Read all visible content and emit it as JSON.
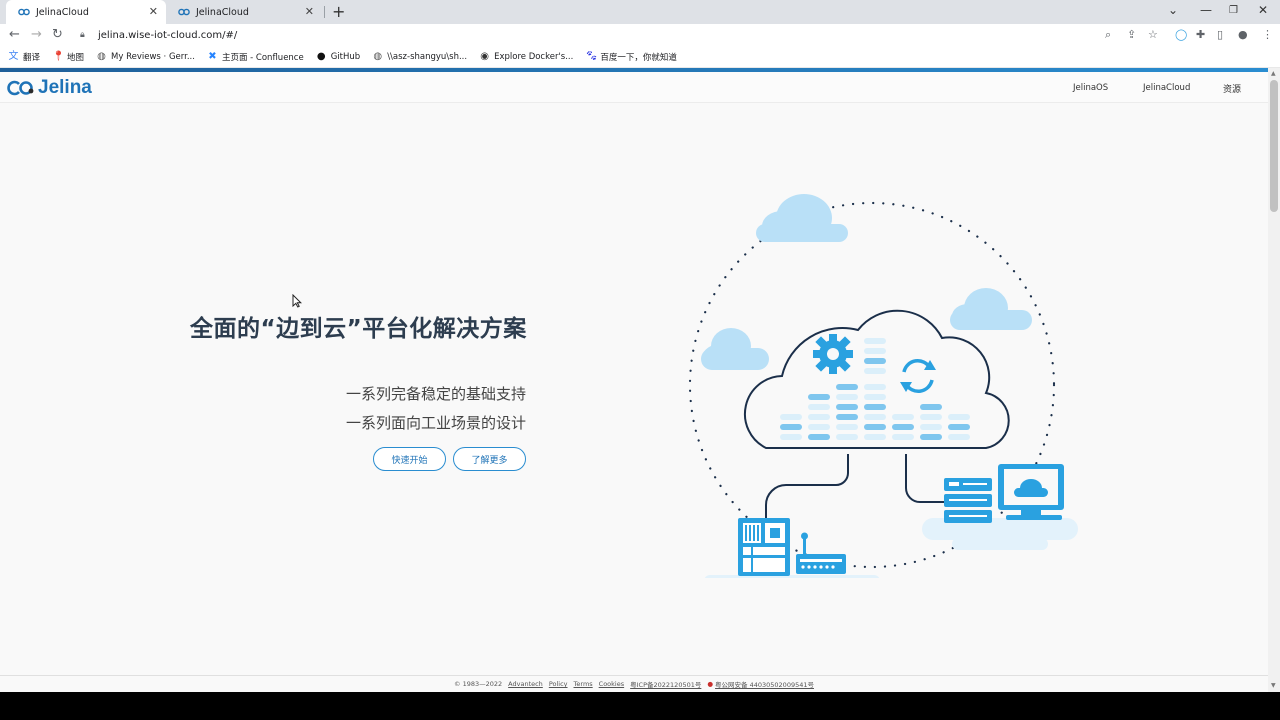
{
  "browser": {
    "tabs": [
      {
        "title": "JelinaCloud",
        "active": true
      },
      {
        "title": "JelinaCloud",
        "active": false
      }
    ],
    "url": "jelina.wise-iot-cloud.com/#/",
    "bookmarks": [
      {
        "label": "翻译",
        "icon": "translate-icon"
      },
      {
        "label": "地图",
        "icon": "maps-pin-icon"
      },
      {
        "label": "My Reviews · Gerr...",
        "icon": "globe-icon"
      },
      {
        "label": "主页面 - Confluence",
        "icon": "confluence-icon"
      },
      {
        "label": "GitHub",
        "icon": "github-icon"
      },
      {
        "label": "\\\\asz-shangyu\\sh...",
        "icon": "globe-icon"
      },
      {
        "label": "Explore Docker's...",
        "icon": "docker-icon"
      },
      {
        "label": "百度一下，你就知道",
        "icon": "baidu-paw-icon"
      }
    ]
  },
  "site": {
    "logo_text": "Jelina",
    "nav": [
      "JelinaOS",
      "JelinaCloud",
      "资源"
    ],
    "brand_color": "#1f73b7"
  },
  "hero": {
    "title": "全面的“边到云”平台化解决方案",
    "subtitles": [
      "一系列完备稳定的基础支持",
      "一系列面向工业场景的设计"
    ],
    "buttons": [
      "快速开始",
      "了解更多"
    ]
  },
  "footer": {
    "copyright": "© 1983—2022",
    "links": [
      "Advantech",
      "Policy",
      "Terms",
      "Cookies",
      "粤ICP备2022120501号"
    ],
    "police": "粤公网安备 44030502009541号"
  }
}
